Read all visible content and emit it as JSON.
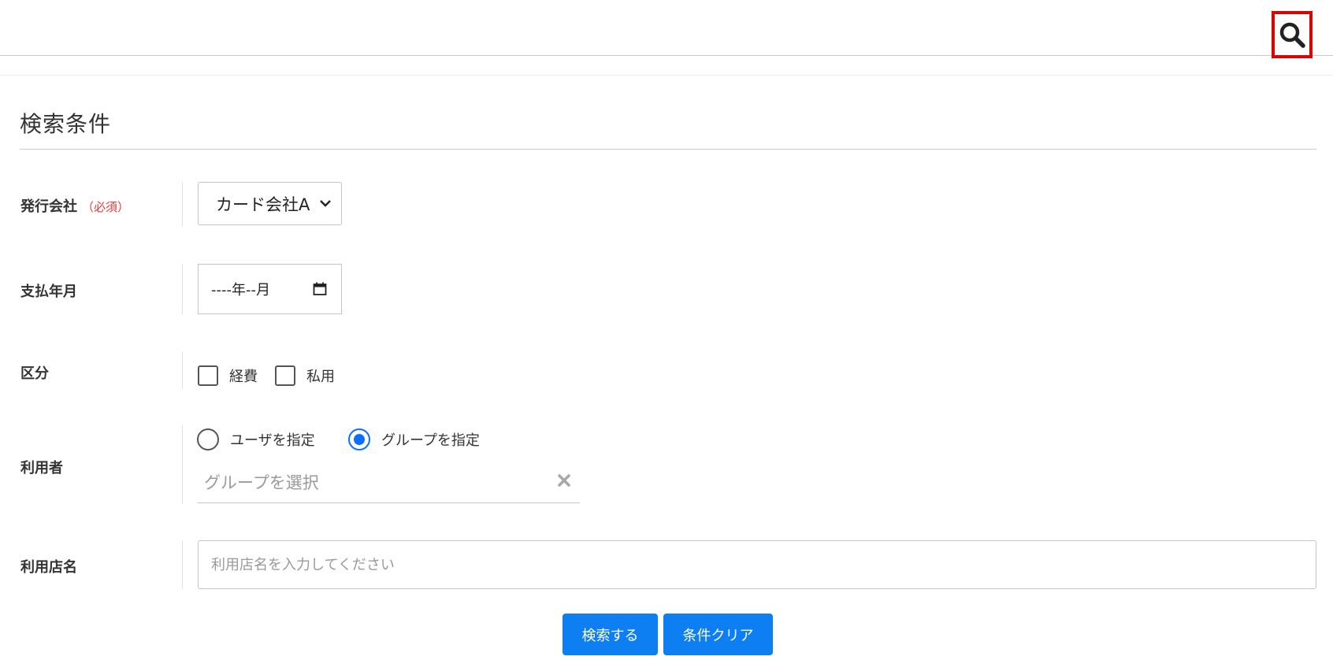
{
  "header": {
    "search_icon": "search-icon"
  },
  "section": {
    "title": "検索条件"
  },
  "issuer": {
    "label": "発行会社",
    "required_tag": "（必須）",
    "selected": "カード会社A"
  },
  "payment_month": {
    "label": "支払年月",
    "value": "----年--月"
  },
  "category": {
    "label": "区分",
    "options": [
      {
        "label": "経費",
        "checked": false
      },
      {
        "label": "私用",
        "checked": false
      }
    ]
  },
  "user": {
    "label": "利用者",
    "radio_options": [
      {
        "label": "ユーザを指定",
        "checked": false
      },
      {
        "label": "グループを指定",
        "checked": true
      }
    ],
    "group_placeholder": "グループを選択"
  },
  "shop": {
    "label": "利用店名",
    "placeholder": "利用店名を入力してください",
    "value": ""
  },
  "actions": {
    "search_label": "検索する",
    "clear_label": "条件クリア"
  },
  "colors": {
    "accent": "#0d7ff2",
    "required": "#e03c3c",
    "highlight_border": "#e00000"
  }
}
